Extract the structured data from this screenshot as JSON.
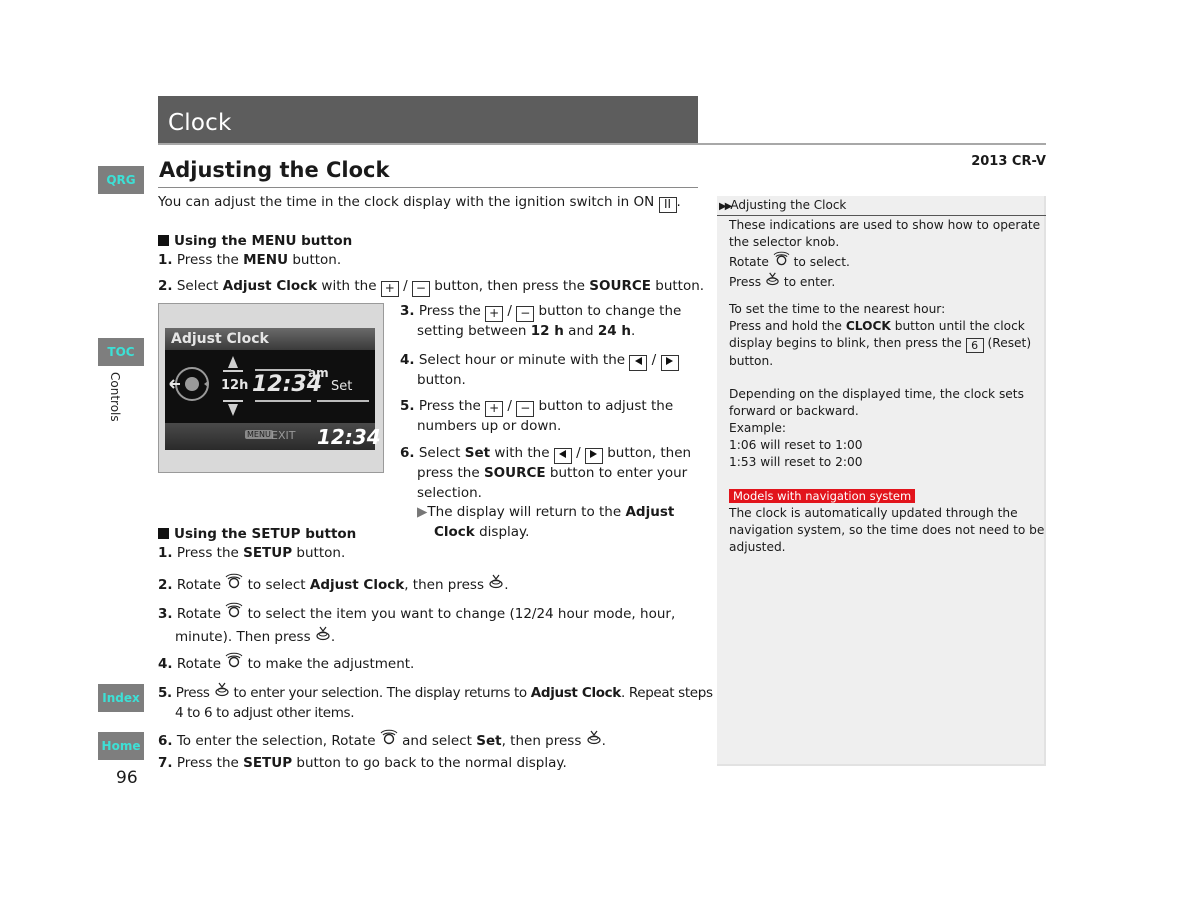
{
  "header": {
    "chapter_title": "Clock",
    "model": "2013 CR-V"
  },
  "side_nav": {
    "tabs": [
      {
        "label": "QRG"
      },
      {
        "label": "TOC"
      },
      {
        "label": "Index"
      },
      {
        "label": "Home"
      }
    ],
    "section_label": "Controls",
    "page_number": "96",
    "tab_text_color": "#3de0d6",
    "tab_bg_color": "#7e7e7e"
  },
  "section": {
    "title": "Adjusting the Clock",
    "intro": "You can adjust the time in the clock display with the ignition switch in ON",
    "intro_key": "II",
    "menu": {
      "heading": "Using the MENU button",
      "steps": [
        {
          "num": "1.",
          "pre": "Press the ",
          "bold": "MENU",
          "post": " button."
        },
        {
          "num": "2.",
          "pre": "Select ",
          "bold": "Adjust Clock",
          "mid": " with the ",
          "post": " button, then press the ",
          "bold2": "SOURCE",
          "end": " button."
        },
        {
          "num": "3.",
          "pre": "Press the ",
          "mid": " button to change the",
          "line2_pre": "setting between ",
          "bold": "12 h",
          "and": " and ",
          "bold2": "24 h",
          "end": "."
        },
        {
          "num": "4.",
          "pre": "Select hour or minute with the ",
          "line2": "button."
        },
        {
          "num": "5.",
          "pre": "Press the ",
          "mid": " button to adjust the",
          "line2": "numbers up or down."
        },
        {
          "num": "6.",
          "pre": "Select ",
          "bold": "Set",
          "mid": " with the ",
          "post": " button, then",
          "line2_pre": "press the ",
          "bold2": "SOURCE",
          "line2_post": " button to enter your",
          "line3": "selection.",
          "result_pre": "The display will return to the ",
          "result_bold": "Adjust",
          "result_bold2": "Clock",
          "result_post": " display."
        }
      ]
    },
    "setup": {
      "heading": "Using the SETUP button",
      "steps": [
        {
          "num": "1.",
          "pre": "Press the ",
          "bold": "SETUP",
          "post": " button."
        },
        {
          "num": "2.",
          "pre": "Rotate ",
          "mid": " to select ",
          "bold": "Adjust Clock",
          "post": ", then press ",
          "end": "."
        },
        {
          "num": "3.",
          "pre": "Rotate ",
          "post": " to select the item you want to change (12/24 hour mode, hour,",
          "line2_pre": "minute). Then press ",
          "end": "."
        },
        {
          "num": "4.",
          "pre": "Rotate ",
          "post": " to make the adjustment."
        },
        {
          "num": "5.",
          "pre": "Press ",
          "mid": " to enter your selection. The display returns to ",
          "bold": "Adjust Clock",
          "post": ". Repeat steps",
          "line2": "4 to 6 to adjust other items."
        },
        {
          "num": "6.",
          "pre": "To enter the selection, Rotate ",
          "mid": " and select ",
          "bold": "Set",
          "post": ", then press ",
          "end": "."
        },
        {
          "num": "7.",
          "pre": "Press the ",
          "bold": "SETUP",
          "post": " button to go back to the normal display."
        }
      ]
    }
  },
  "screen": {
    "title": "Adjust Clock",
    "mode": "12h",
    "time": "12:34",
    "ampm": "am",
    "set": "Set",
    "menu_badge": "MENU",
    "exit": "EXIT",
    "clock": "12:34"
  },
  "note": {
    "heading": "Adjusting the Clock",
    "lines_a": [
      "These indications are used to show how to operate",
      "the selector knob."
    ],
    "rotate_pre": "Rotate ",
    "rotate_post": " to select.",
    "press_pre": "Press ",
    "press_post": " to enter.",
    "nearest_1": "To set the time to the nearest hour:",
    "nearest_2_pre": "Press and hold the ",
    "nearest_2_bold": "CLOCK",
    "nearest_2_post": " button until the clock",
    "nearest_3_pre": "display begins to blink, then press the ",
    "nearest_3_key": "6",
    "nearest_3_post": " (Reset)",
    "nearest_4": "button.",
    "depend": [
      "Depending on the displayed time, the clock sets",
      "forward or backward.",
      "Example:",
      "1:06 will reset to 1:00",
      "1:53 will reset to 2:00"
    ],
    "nav_tag": "Models with navigation system",
    "nav_tag_color": "#e2141c",
    "nav_text": [
      "The clock is automatically updated through the",
      "navigation system, so the time does not need to be",
      "adjusted."
    ]
  }
}
